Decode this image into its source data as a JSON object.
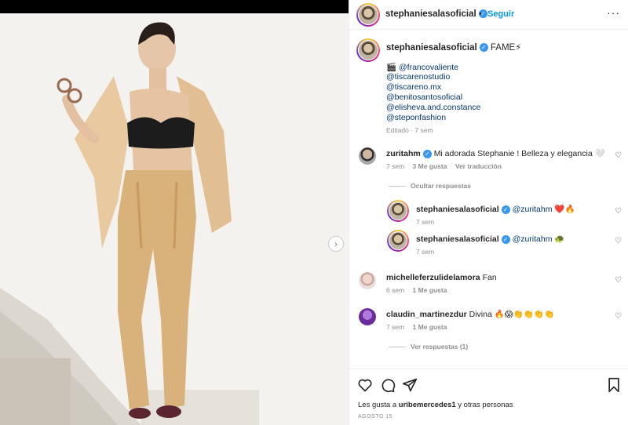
{
  "post": {
    "username": "stephaniesalasoficial",
    "separator": "•",
    "follow_label": "Seguir",
    "more_label": "···"
  },
  "caption": {
    "username": "stephaniesalasoficial",
    "title": "FAME⚡",
    "lines": [
      "🎬 @francovaliente",
      "@tiscarenostudio",
      "@tiscareno.mx",
      "@benitosantosoficial",
      "@elisheva.and.constance",
      "@steponfashion"
    ],
    "meta": "Editado · 7 sem"
  },
  "comments": [
    {
      "username": "zuritahm",
      "text": "Mi adorada Stephanie ! Belleza y elegancia 🤍",
      "time": "7 sem",
      "likes": "3 Me gusta",
      "action": "Ver traducción",
      "replies_toggle": "Ocultar respuestas"
    },
    {
      "username": "stephaniesalasoficial",
      "text": "@zuritahm ❤️🔥",
      "time": "7 sem"
    },
    {
      "username": "stephaniesalasoficial",
      "text": "@zuritahm 🐢",
      "time": "7 sem"
    },
    {
      "username": "michelleferzulidelamora",
      "text": "Fan",
      "time": "6 sem",
      "likes": "1 Me gusta"
    },
    {
      "username": "claudin_martinezdur",
      "text": "Divina 🔥😱👏👏👏👏",
      "time": "7 sem",
      "likes": "1 Me gusta",
      "replies_toggle": "Ver respuestas (1)"
    }
  ],
  "footer": {
    "likes_prefix": "Les gusta a ",
    "likes_user": "uribemercedes1",
    "likes_suffix": " y otras personas",
    "date": "AGOSTO 15"
  },
  "icons": {
    "next": "chevron-right-icon",
    "like": "heart-icon",
    "comment": "comment-icon",
    "share": "paper-plane-icon",
    "save": "bookmark-icon"
  },
  "colors": {
    "link": "#00376b",
    "follow": "#0095f6",
    "verified": "#3897f0",
    "muted": "#8e8e8e"
  }
}
